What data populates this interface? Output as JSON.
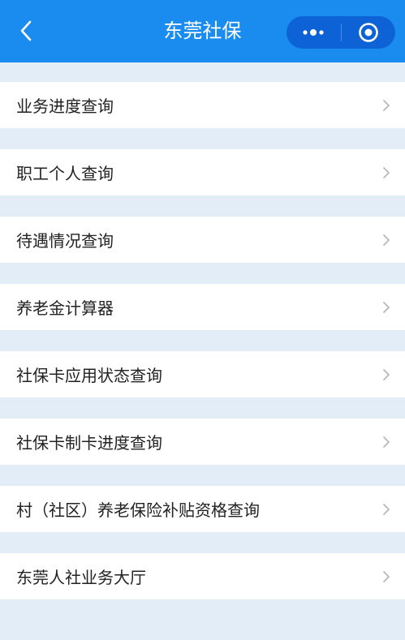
{
  "header": {
    "title": "东莞社保",
    "background_color": "#1a8cf0",
    "back_icon": "chevron-left-icon",
    "capsule": {
      "more_icon": "more-dots-icon",
      "close_icon": "target-circle-icon"
    }
  },
  "menu": {
    "items": [
      {
        "label": "业务进度查询"
      },
      {
        "label": "职工个人查询"
      },
      {
        "label": "待遇情况查询"
      },
      {
        "label": "养老金计算器"
      },
      {
        "label": "社保卡应用状态查询"
      },
      {
        "label": "社保卡制卡进度查询"
      },
      {
        "label": "村（社区）养老保险补贴资格查询"
      },
      {
        "label": "东莞人社业务大厅"
      }
    ],
    "chevron_icon": "chevron-right-icon"
  },
  "colors": {
    "page_background": "#e2edf7",
    "item_background": "#ffffff",
    "accent": "#1a8cf0"
  }
}
